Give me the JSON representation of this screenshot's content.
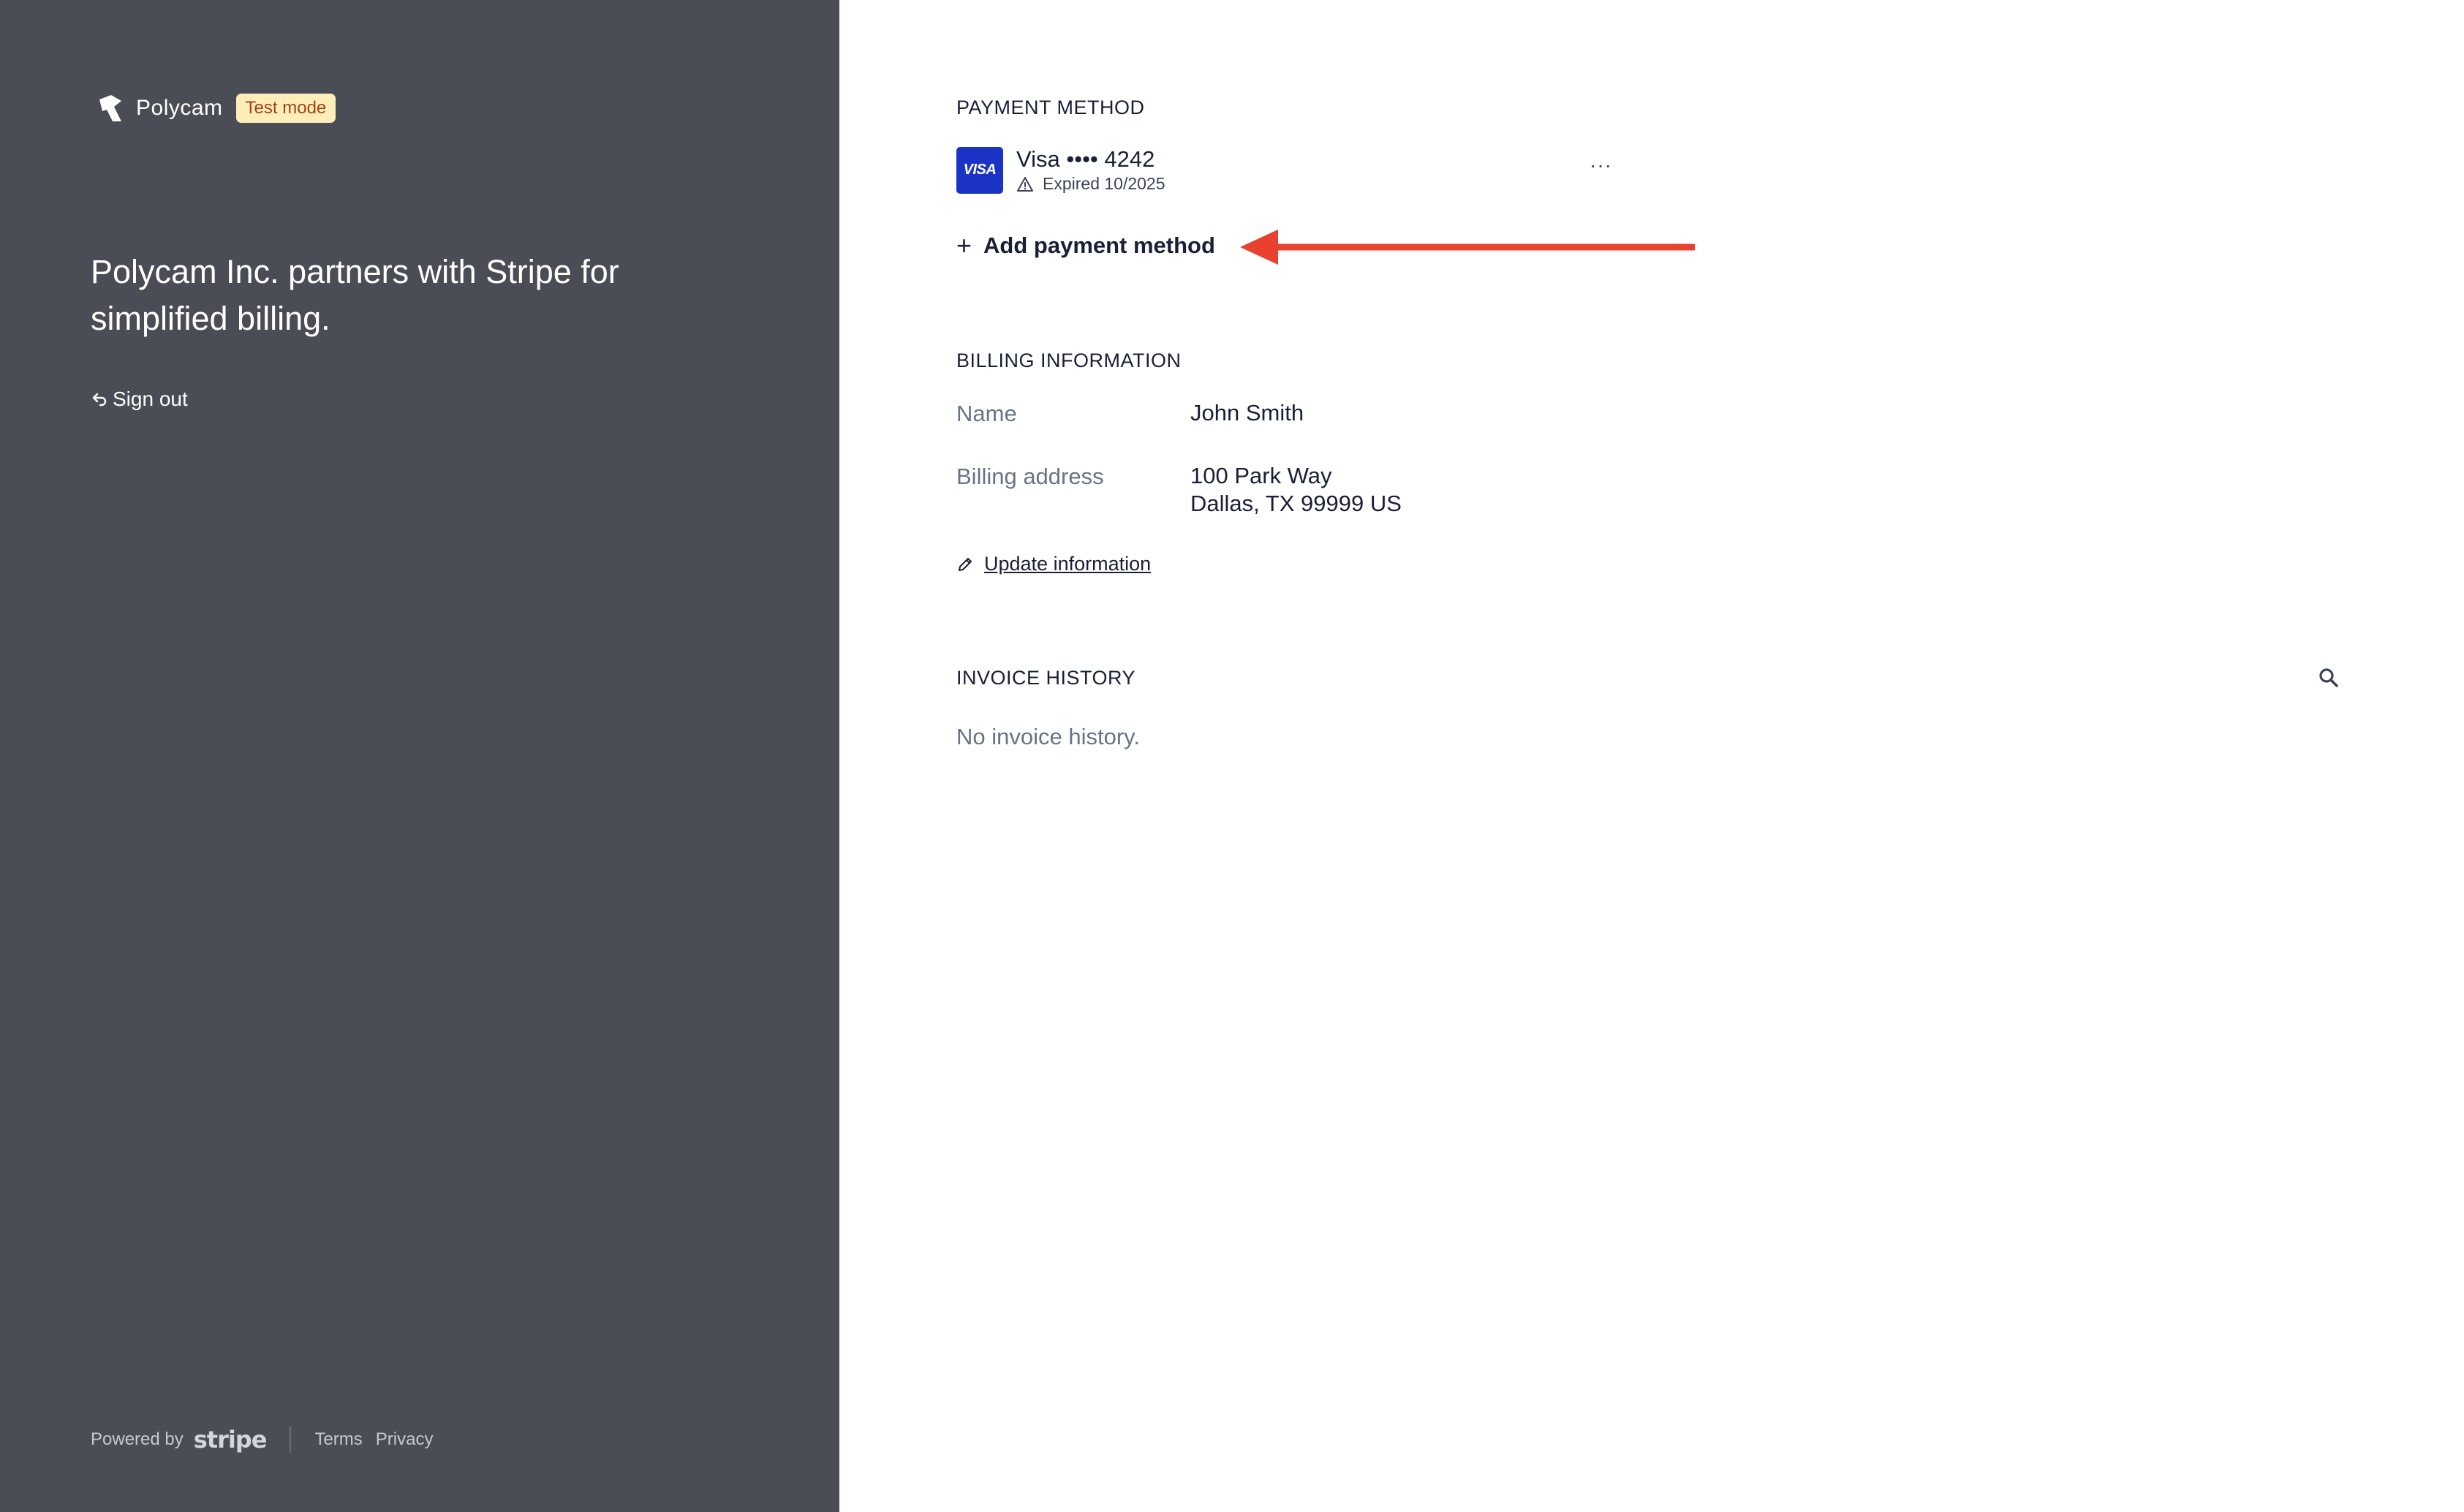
{
  "brand": {
    "name": "Polycam",
    "badge": "Test mode"
  },
  "sidebar": {
    "headline": "Polycam Inc. partners with Stripe for simplified billing.",
    "sign_out": "Sign out",
    "footer": {
      "powered_by": "Powered by",
      "provider": "stripe",
      "terms": "Terms",
      "privacy": "Privacy"
    }
  },
  "payment_method": {
    "title": "PAYMENT METHOD",
    "card": {
      "brand_icon": "VISA",
      "label": "Visa •••• 4242",
      "status": "Expired 10/2025"
    },
    "more_label": "···",
    "add_label": "Add payment method"
  },
  "billing": {
    "title": "BILLING INFORMATION",
    "name_label": "Name",
    "name_value": "John Smith",
    "address_label": "Billing address",
    "address_line1": "100 Park Way",
    "address_line2": "Dallas, TX 99999 US",
    "update_label": "Update information"
  },
  "invoices": {
    "title": "INVOICE HISTORY",
    "empty": "No invoice history."
  },
  "colors": {
    "sidebar_bg": "#4a4d55",
    "visa_blue": "#1a33c4",
    "annotation_arrow": "#e8412f",
    "badge_bg": "#fcedb9"
  }
}
